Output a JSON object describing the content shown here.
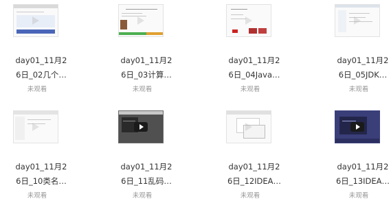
{
  "videos": [
    {
      "line1": "day01_11月2",
      "line2": "6日_02几个…",
      "status": "未观看",
      "thumb": "slides-blue"
    },
    {
      "line1": "day01_11月2",
      "line2": "6日_03计算…",
      "status": "未观看",
      "thumb": "doc-green"
    },
    {
      "line1": "day01_11月2",
      "line2": "6日_04Java…",
      "status": "未观看",
      "thumb": "doc-red"
    },
    {
      "line1": "day01_11月2",
      "line2": "6日_05JDK…",
      "status": "未观看",
      "thumb": "installer"
    },
    {
      "line1": "day01_11月2",
      "line2": "6日_10类名…",
      "status": "未观看",
      "thumb": "explorer"
    },
    {
      "line1": "day01_11月2",
      "line2": "6日_11乱码…",
      "status": "未观看",
      "thumb": "dark-video"
    },
    {
      "line1": "day01_11月2",
      "line2": "6日_12IDEA…",
      "status": "未观看",
      "thumb": "dialogs"
    },
    {
      "line1": "day01_11月2",
      "line2": "6日_13IDEA…",
      "status": "未观看",
      "thumb": "navy-video"
    }
  ],
  "colors": {
    "title": "#333333",
    "status": "#999999",
    "play_button": "#1a1a1a"
  }
}
